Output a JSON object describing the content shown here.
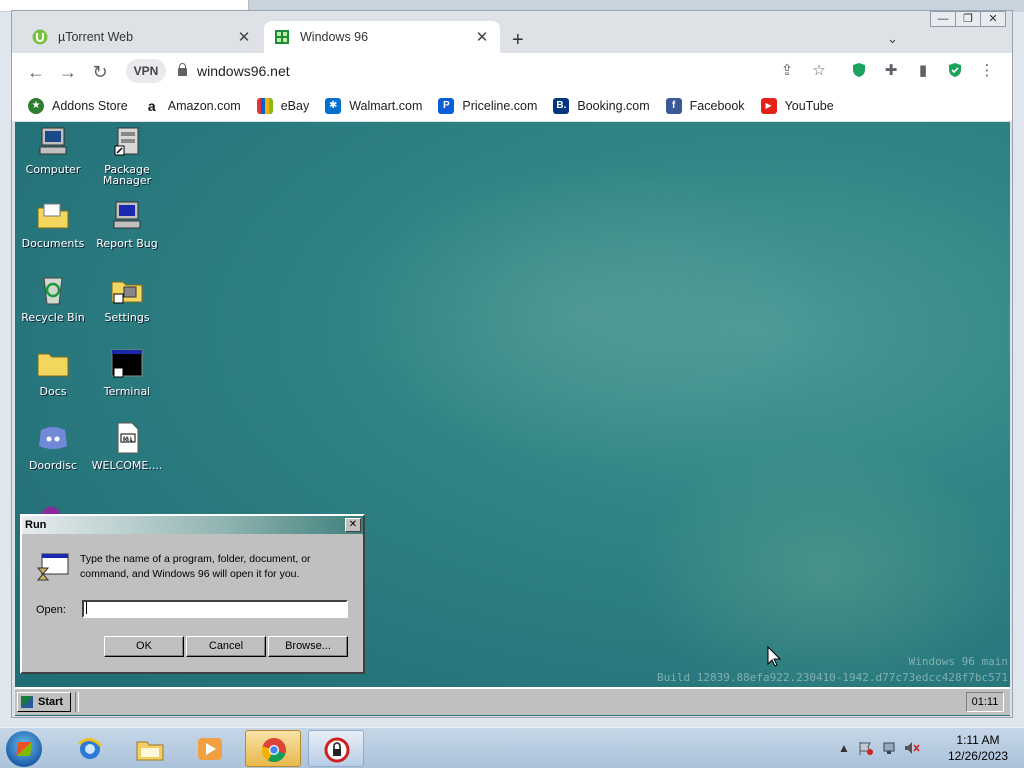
{
  "browser": {
    "tabs": [
      {
        "title": "µTorrent Web",
        "active": false
      },
      {
        "title": "Windows 96",
        "active": true
      }
    ],
    "new_tab_label": "+",
    "vpn_label": "VPN",
    "url": "windows96.net",
    "bookmarks": [
      {
        "label": "Addons Store",
        "icon": "addons-store-icon",
        "color": "#2e7d32"
      },
      {
        "label": "Amazon.com",
        "icon": "amazon-icon",
        "color": "#111111"
      },
      {
        "label": "eBay",
        "icon": "ebay-icon",
        "color": "#e53238"
      },
      {
        "label": "Walmart.com",
        "icon": "walmart-icon",
        "color": "#0071ce"
      },
      {
        "label": "Priceline.com",
        "icon": "priceline-icon",
        "color": "#0a5fd6"
      },
      {
        "label": "Booking.com",
        "icon": "booking-icon",
        "color": "#003580"
      },
      {
        "label": "Facebook",
        "icon": "facebook-icon",
        "color": "#3b5998"
      },
      {
        "label": "YouTube",
        "icon": "youtube-icon",
        "color": "#e62117"
      }
    ]
  },
  "w96": {
    "desktop_icons": [
      {
        "label": "Computer",
        "icon": "computer-icon"
      },
      {
        "label": "Package Manager",
        "icon": "package-manager-icon"
      },
      {
        "label": "Documents",
        "icon": "documents-folder-icon"
      },
      {
        "label": "Report Bug",
        "icon": "report-bug-icon"
      },
      {
        "label": "Recycle Bin",
        "icon": "recycle-bin-icon"
      },
      {
        "label": "Settings",
        "icon": "settings-icon"
      },
      {
        "label": "Docs",
        "icon": "docs-folder-icon"
      },
      {
        "label": "Terminal",
        "icon": "terminal-icon"
      },
      {
        "label": "Doordisc",
        "icon": "doordisc-icon"
      },
      {
        "label": "WELCOME....",
        "icon": "markdown-file-icon"
      }
    ],
    "build_line1": "Windows 96 main",
    "build_line2": "Build 12839.88efa922.230410-1942.d77c73edcc428f7bc571",
    "run_dialog": {
      "title": "Run",
      "description": "Type the name of a program, folder, document, or command, and Windows 96 will open it for you.",
      "open_label": "Open:",
      "open_value": "",
      "ok_label": "OK",
      "cancel_label": "Cancel",
      "browse_label": "Browse..."
    },
    "taskbar": {
      "start_label": "Start",
      "clock": "01:11"
    }
  },
  "win7": {
    "time": "1:11 AM",
    "date": "12/26/2023"
  }
}
